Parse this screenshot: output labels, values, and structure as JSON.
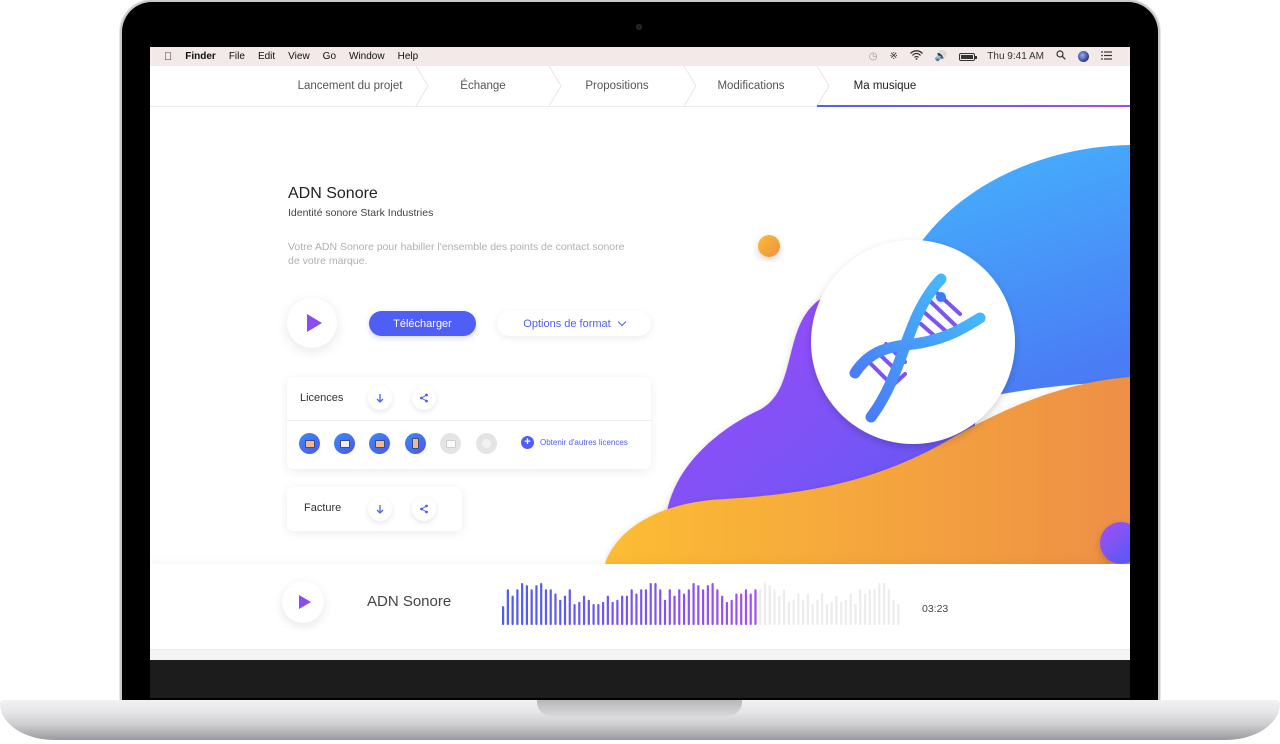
{
  "menubar": {
    "apple_icon": "apple-icon",
    "items": [
      "Finder",
      "File",
      "Edit",
      "View",
      "Go",
      "Window",
      "Help"
    ],
    "status_icons": [
      "time-machine-icon",
      "bluetooth-icon",
      "wifi-icon",
      "volume-icon",
      "battery-icon"
    ],
    "clock": "Thu 9:41 AM",
    "right_icons": [
      "spotlight-search-icon",
      "siri-icon",
      "notification-center-icon"
    ]
  },
  "tabs": [
    {
      "label": "Lancement du projet",
      "active": false
    },
    {
      "label": "Échange",
      "active": false
    },
    {
      "label": "Propositions",
      "active": false
    },
    {
      "label": "Modifications",
      "active": false
    },
    {
      "label": "Ma musique",
      "active": true
    }
  ],
  "main": {
    "title": "ADN Sonore",
    "subtitle": "Identité sonore Stark Industries",
    "description": "Votre ADN Sonore pour habiller l'ensemble des points de contact sonore de votre marque.",
    "download_label": "Télécharger",
    "format_options_label": "Options de format"
  },
  "licences": {
    "label": "Licences",
    "icons": [
      {
        "name": "tv-licence-icon",
        "active": true
      },
      {
        "name": "radio-licence-icon",
        "active": true
      },
      {
        "name": "desktop-licence-icon",
        "active": true
      },
      {
        "name": "mobile-licence-icon",
        "active": true
      },
      {
        "name": "store-licence-icon",
        "active": false
      },
      {
        "name": "event-licence-icon",
        "active": false
      }
    ],
    "more_label": "Obtenir d'autres licences"
  },
  "facture": {
    "label": "Facture"
  },
  "player": {
    "title": "ADN Sonore",
    "duration": "03:23",
    "progress": 0.64,
    "waveform": [
      0.45,
      0.85,
      0.7,
      0.85,
      1.0,
      0.95,
      0.85,
      0.95,
      1.0,
      0.85,
      0.85,
      0.75,
      0.6,
      0.7,
      0.85,
      0.5,
      0.55,
      0.7,
      0.6,
      0.5,
      0.5,
      0.55,
      0.7,
      0.55,
      0.6,
      0.7,
      0.7,
      0.85,
      0.75,
      0.85,
      0.85,
      1.0,
      1.0,
      0.85,
      0.6,
      0.85,
      0.7,
      0.85,
      0.75,
      0.85,
      1.0,
      0.95,
      0.85,
      0.95,
      1.0,
      0.85,
      0.7,
      0.55,
      0.6,
      0.75,
      0.75,
      0.85,
      0.75,
      0.85,
      0.85,
      1.0,
      0.95,
      0.85,
      0.7,
      0.85,
      0.55,
      0.6,
      0.75,
      0.6,
      0.75,
      0.5,
      0.6,
      0.75,
      0.5,
      0.55,
      0.7,
      0.55,
      0.6,
      0.75,
      0.5,
      0.85,
      0.75,
      0.85,
      0.85,
      1.0,
      1.0,
      0.85,
      0.6,
      0.5
    ],
    "colors": {
      "start": "#4b5cf5",
      "end": "#a24ef2",
      "unplayed": "#ececec"
    }
  },
  "colors": {
    "accent": "#4f5ef5",
    "purple": "#8b4df2",
    "blob_blue": "#45aefc",
    "blob_purple": "#9b4df6",
    "blob_orange": "#f09a45",
    "blob_yellow": "#fbbd35"
  }
}
